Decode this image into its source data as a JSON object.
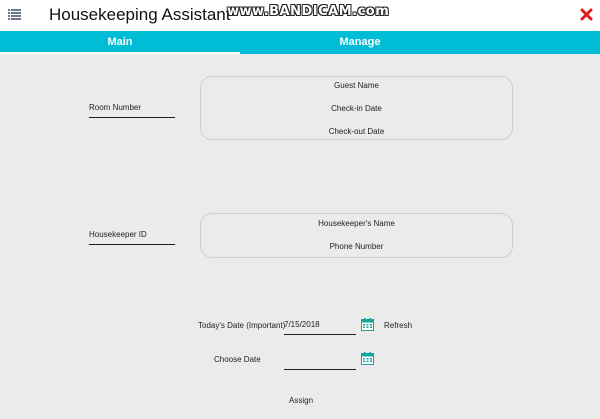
{
  "app": {
    "title": "Housekeeping Assistant",
    "watermark": "www.BANDICAM.com",
    "accent_color": "#00bcd4",
    "close_color": "#e01b1b"
  },
  "tabs": [
    {
      "label": "Main",
      "active": true
    },
    {
      "label": "Manage",
      "active": false
    }
  ],
  "room": {
    "room_number_placeholder": "Room Number",
    "guest_name_label": "Guest Name",
    "check_in_label": "Check-in Date",
    "check_out_label": "Check-out Date"
  },
  "housekeeper": {
    "id_placeholder": "Housekeeper ID",
    "name_label": "Housekeeper's Name",
    "phone_label": "Phone Number"
  },
  "dates": {
    "today_label": "Today's Date (Important)",
    "today_value": "7/15/2018",
    "refresh_label": "Refresh",
    "choose_label": "Choose Date",
    "choose_value": ""
  },
  "actions": {
    "assign_label": "Assign"
  },
  "icons": {
    "menu": "menu-icon",
    "close": "close-icon",
    "calendar": "calendar-icon"
  }
}
